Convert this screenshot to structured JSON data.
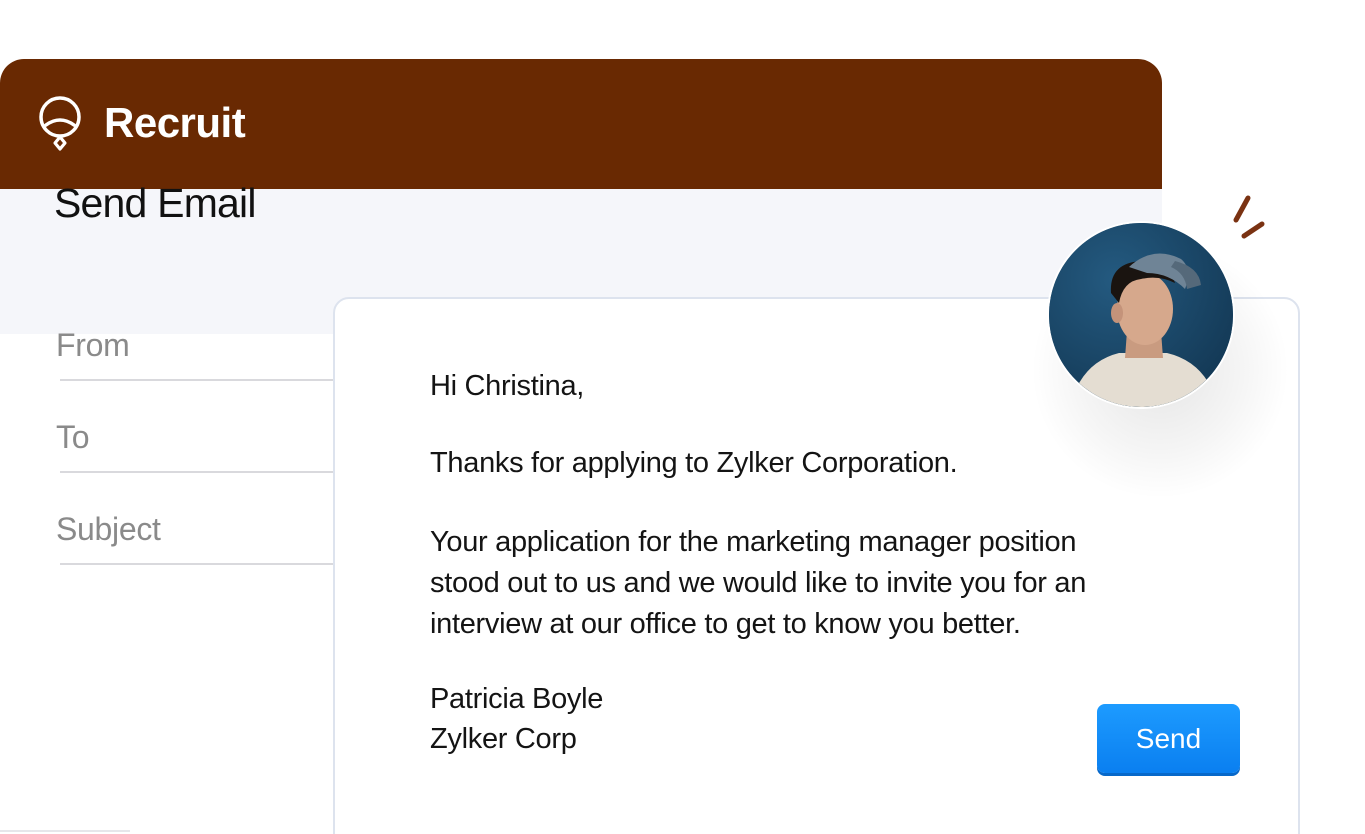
{
  "app": {
    "name": "Recruit",
    "logo_icon": "recruit-pin-icon",
    "header_color": "#692902"
  },
  "page": {
    "title": "Send Email"
  },
  "form": {
    "from_label": "From",
    "to_label": "To",
    "subject_label": "Subject"
  },
  "email": {
    "greeting": "Hi Christina,",
    "thanks": "Thanks for applying to Zylker Corporation.",
    "paragraph_lines": [
      "Your application for the marketing manager position",
      "stood out to us and we would like to invite you for an",
      "interview at our office to get to know you better."
    ],
    "signature_name": "Patricia Boyle",
    "signature_company": "Zylker Corp"
  },
  "actions": {
    "send_label": "Send",
    "send_color": "#1a8cff"
  },
  "avatar": {
    "icon": "candidate-avatar",
    "accent_color": "#7a3212"
  }
}
